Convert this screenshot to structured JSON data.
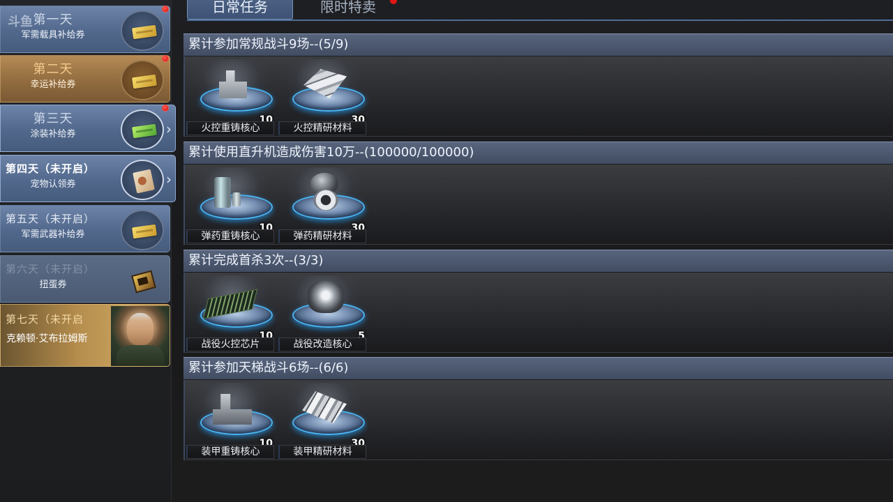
{
  "sidebar": {
    "logo_text": "斗鱼",
    "days": [
      {
        "title": "第一天",
        "reward": "军需载具补给券",
        "reward_icon": "vehicle-ticket-icon",
        "badge": true
      },
      {
        "title": "第二天",
        "reward": "幸运补给券",
        "reward_icon": "lucky-ticket-icon",
        "badge": true
      },
      {
        "title": "第三天",
        "reward": "涂装补给券",
        "reward_icon": "paint-ticket-icon",
        "badge": true
      },
      {
        "title": "第四天（未开启）",
        "reward": "宠物认领券",
        "reward_icon": "pet-voucher-icon",
        "badge": false
      },
      {
        "title": "第五天（未开启）",
        "reward": "军需武器补给券",
        "reward_icon": "weapon-ticket-icon",
        "badge": false
      },
      {
        "title": "第六天（未开启）",
        "reward": "扭蛋券",
        "reward_icon": "gacha-ticket-icon",
        "badge": false
      },
      {
        "title": "第七天（未开启",
        "reward": "克赖顿·艾布拉姆斯",
        "reward_icon": "commander-portrait",
        "badge": false
      }
    ]
  },
  "tabs": [
    {
      "label": "日常任务",
      "active": true
    },
    {
      "label": "限时特卖",
      "active": false,
      "badge": true
    }
  ],
  "tasks": [
    {
      "title": "累计参加常规战斗9场--(5/9)",
      "rewards": [
        {
          "name": "火控重铸核心",
          "qty": "10",
          "icon": "fire-control-recast-core-icon"
        },
        {
          "name": "火控精研材料",
          "qty": "30",
          "icon": "fire-control-material-icon"
        }
      ]
    },
    {
      "title": "累计使用直升机造成伤害10万--(100000/100000)",
      "rewards": [
        {
          "name": "弹药重铸核心",
          "qty": "10",
          "icon": "ammo-recast-core-icon"
        },
        {
          "name": "弹药精研材料",
          "qty": "30",
          "icon": "ammo-material-icon"
        }
      ]
    },
    {
      "title": "累计完成首杀3次--(3/3)",
      "rewards": [
        {
          "name": "战役火控芯片",
          "qty": "10",
          "icon": "campaign-fire-chip-icon"
        },
        {
          "name": "战役改造核心",
          "qty": "5",
          "icon": "campaign-mod-core-icon"
        }
      ]
    },
    {
      "title": "累计参加天梯战斗6场--(6/6)",
      "rewards": [
        {
          "name": "装甲重铸核心",
          "qty": "10",
          "icon": "armor-recast-core-icon"
        },
        {
          "name": "装甲精研材料",
          "qty": "30",
          "icon": "armor-material-icon"
        }
      ]
    }
  ],
  "colors": {
    "accent_blue": "#4ab4f0",
    "badge_red": "#e01515",
    "gold_card": "#b58a55"
  }
}
